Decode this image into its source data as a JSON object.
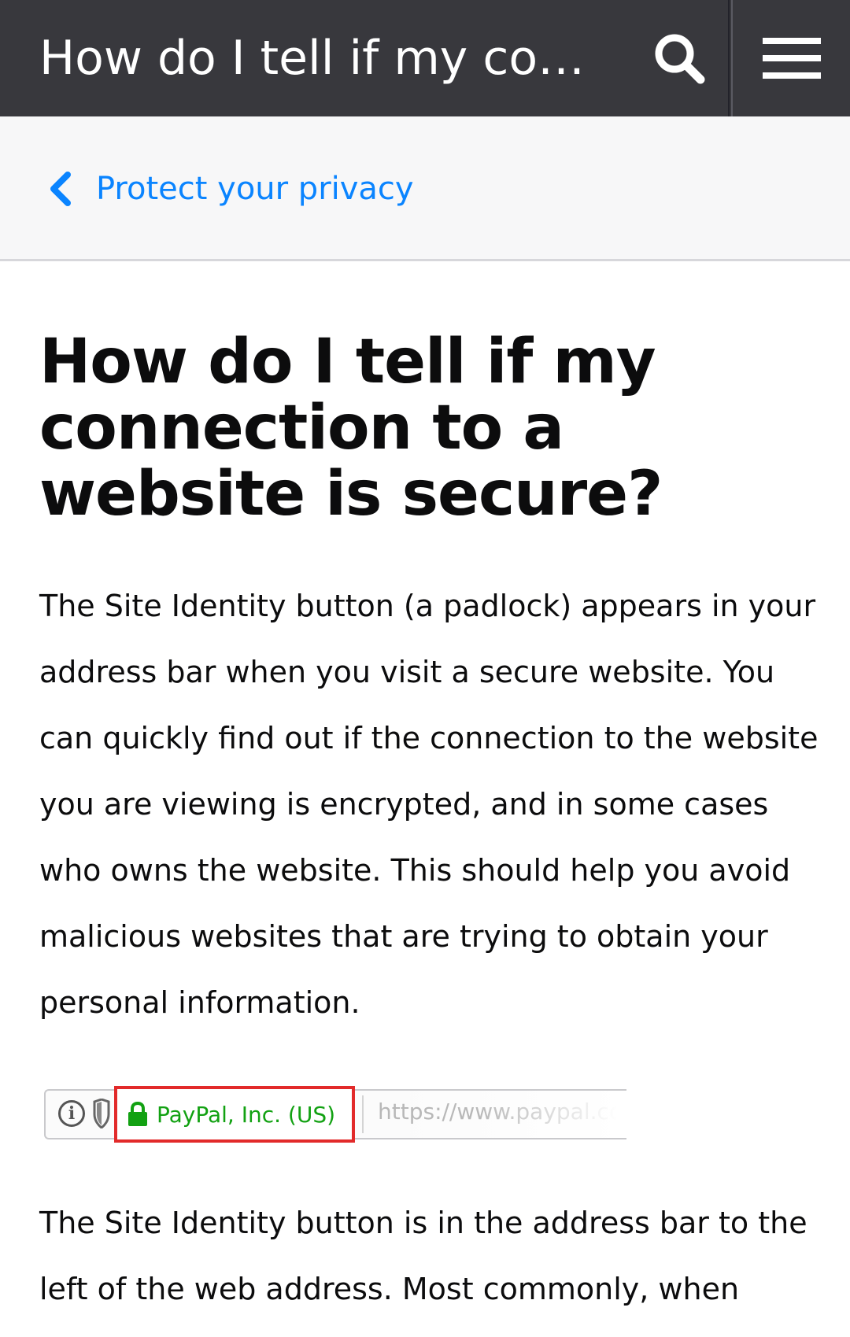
{
  "header": {
    "title": "How do I tell if my co…",
    "search_icon": "search-icon",
    "menu_icon": "hamburger-menu-icon",
    "background": "#38383d"
  },
  "breadcrumb": {
    "label": "Protect your privacy",
    "icon": "chevron-left-icon",
    "color": "#0a84ff"
  },
  "article": {
    "title": "How do I tell if my connection to a website is secure?",
    "intro": "The Site Identity button (a padlock) appears in your address bar when you visit a secure website. You can quickly find out if the connection to the website you are viewing is encrypted, and in some cases who owns the website. This should help you avoid malicious websites that are trying to obtain your personal information.",
    "figure": {
      "info_glyph": "i",
      "identity_label": "PayPal, Inc. (US)",
      "url_text": "https://www.paypal.co",
      "lock_icon": "padlock-icon",
      "highlight_color": "#e22a2a",
      "identity_color": "#12a112"
    },
    "body": "The Site Identity button is in the address bar to the left of the web address. Most commonly, when"
  }
}
